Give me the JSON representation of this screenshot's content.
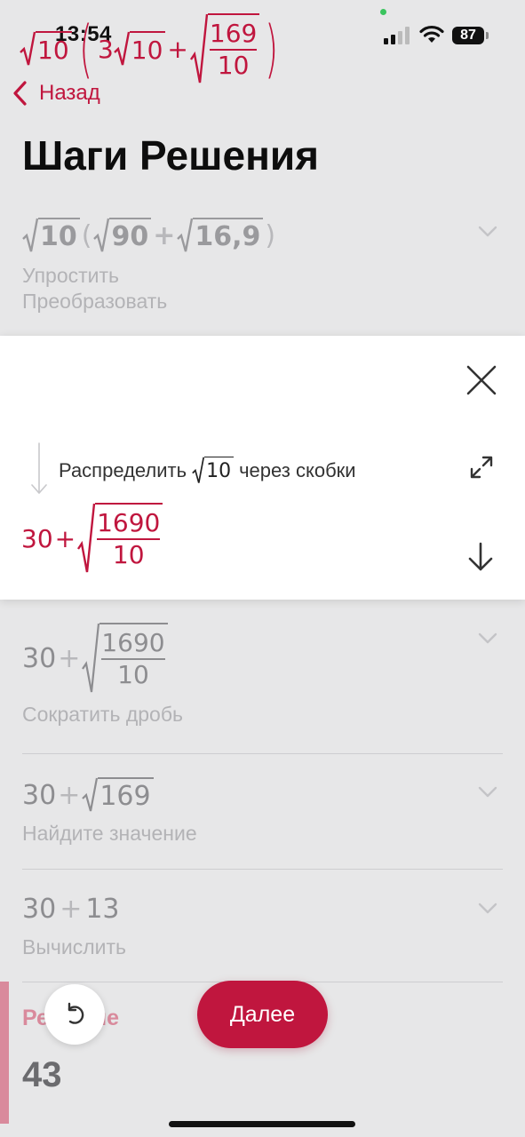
{
  "status_bar": {
    "time": "13:54",
    "battery": "87"
  },
  "nav": {
    "back_label": "Назад"
  },
  "page_title": "Шаги Решения",
  "steps": [
    {
      "expr": {
        "a": "10",
        "b": "90",
        "c": "16,9",
        "plus": "+",
        "lparen": "(",
        "rparen": ")"
      },
      "desc_line1": "Упростить",
      "desc_line2": "Преобразовать"
    },
    {
      "expr": {
        "lead": "30",
        "plus": "+",
        "num": "1690",
        "den": "10"
      },
      "desc": "Сократить дробь"
    },
    {
      "expr": {
        "lead": "30",
        "plus": "+",
        "rad": "169"
      },
      "desc": "Найдите значение"
    },
    {
      "expr": {
        "lead": "30",
        "plus": "+",
        "b": "13"
      },
      "desc": "Вычислить"
    }
  ],
  "active_card": {
    "from": {
      "a": "10",
      "coef": "3",
      "b": "10",
      "plus": "+",
      "num": "169",
      "den": "10"
    },
    "instruction_pre": "Распределить",
    "instruction_rad": "10",
    "instruction_post": "через скобки",
    "to": {
      "lead": "30",
      "plus": "+",
      "num": "1690",
      "den": "10"
    }
  },
  "solution": {
    "label": "Решение",
    "value": "43"
  },
  "next_button": "Далее",
  "icons": {
    "back": "chevron-left-icon",
    "close": "close-icon",
    "expand": "expand-icon",
    "down": "arrow-down-icon",
    "undo": "undo-icon",
    "chevron": "chevron-down-icon"
  },
  "colors": {
    "accent": "#c0163e",
    "background": "#e7e7e8",
    "card": "#ffffff"
  }
}
